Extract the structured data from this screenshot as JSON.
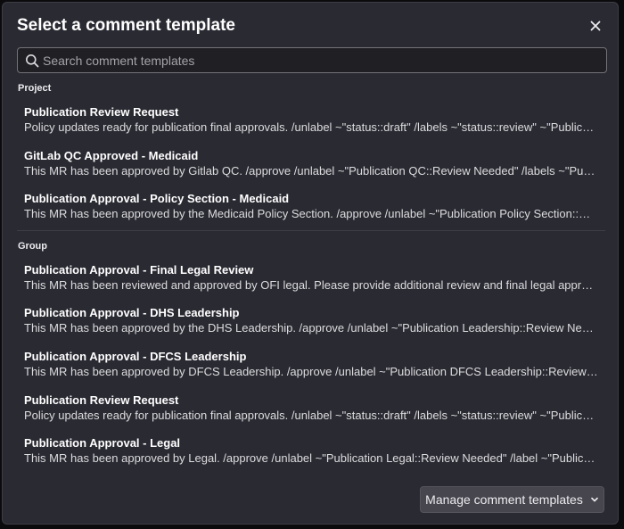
{
  "modal": {
    "title": "Select a comment template",
    "close_icon": "close-icon"
  },
  "search": {
    "placeholder": "Search comment templates",
    "value": "",
    "icon": "search-icon"
  },
  "sections": [
    {
      "label": "Project",
      "items": [
        {
          "name": "Publication Review Request",
          "desc": "Policy updates ready for publication final approvals. /unlabel ~\"status::draft\" /labels ~\"status::review\" ~\"Publication Review::Requested\""
        },
        {
          "name": "GitLab QC Approved - Medicaid",
          "desc": "This MR has been approved by Gitlab QC. /approve /unlabel ~\"Publication QC::Review Needed\" /labels ~\"Publication QC::Approved\""
        },
        {
          "name": "Publication Approval - Policy Section - Medicaid",
          "desc": "This MR has been approved by the Medicaid Policy Section. /approve /unlabel ~\"Publication Policy Section::Review Needed\""
        }
      ]
    },
    {
      "label": "Group",
      "items": [
        {
          "name": "Publication Approval - Final Legal Review",
          "desc": "This MR has been reviewed and approved by OFI legal. Please provide additional review and final legal approval."
        },
        {
          "name": "Publication Approval - DHS Leadership",
          "desc": "This MR has been approved by the DHS Leadership. /approve /unlabel ~\"Publication Leadership::Review Needed\""
        },
        {
          "name": "Publication Approval - DFCS Leadership",
          "desc": "This MR has been approved by DFCS Leadership. /approve /unlabel ~\"Publication DFCS Leadership::Review Needed\""
        },
        {
          "name": "Publication Review Request",
          "desc": "Policy updates ready for publication final approvals. /unlabel ~\"status::draft\" /labels ~\"status::review\" ~\"Publication Review::Requested\""
        },
        {
          "name": "Publication Approval - Legal",
          "desc": "This MR has been approved by Legal. /approve /unlabel ~\"Publication Legal::Review Needed\" /label ~\"Publication Legal::Approved\""
        }
      ]
    }
  ],
  "footer": {
    "manage_label": "Manage comment templates",
    "manage_icon": "chevron-down-icon"
  }
}
